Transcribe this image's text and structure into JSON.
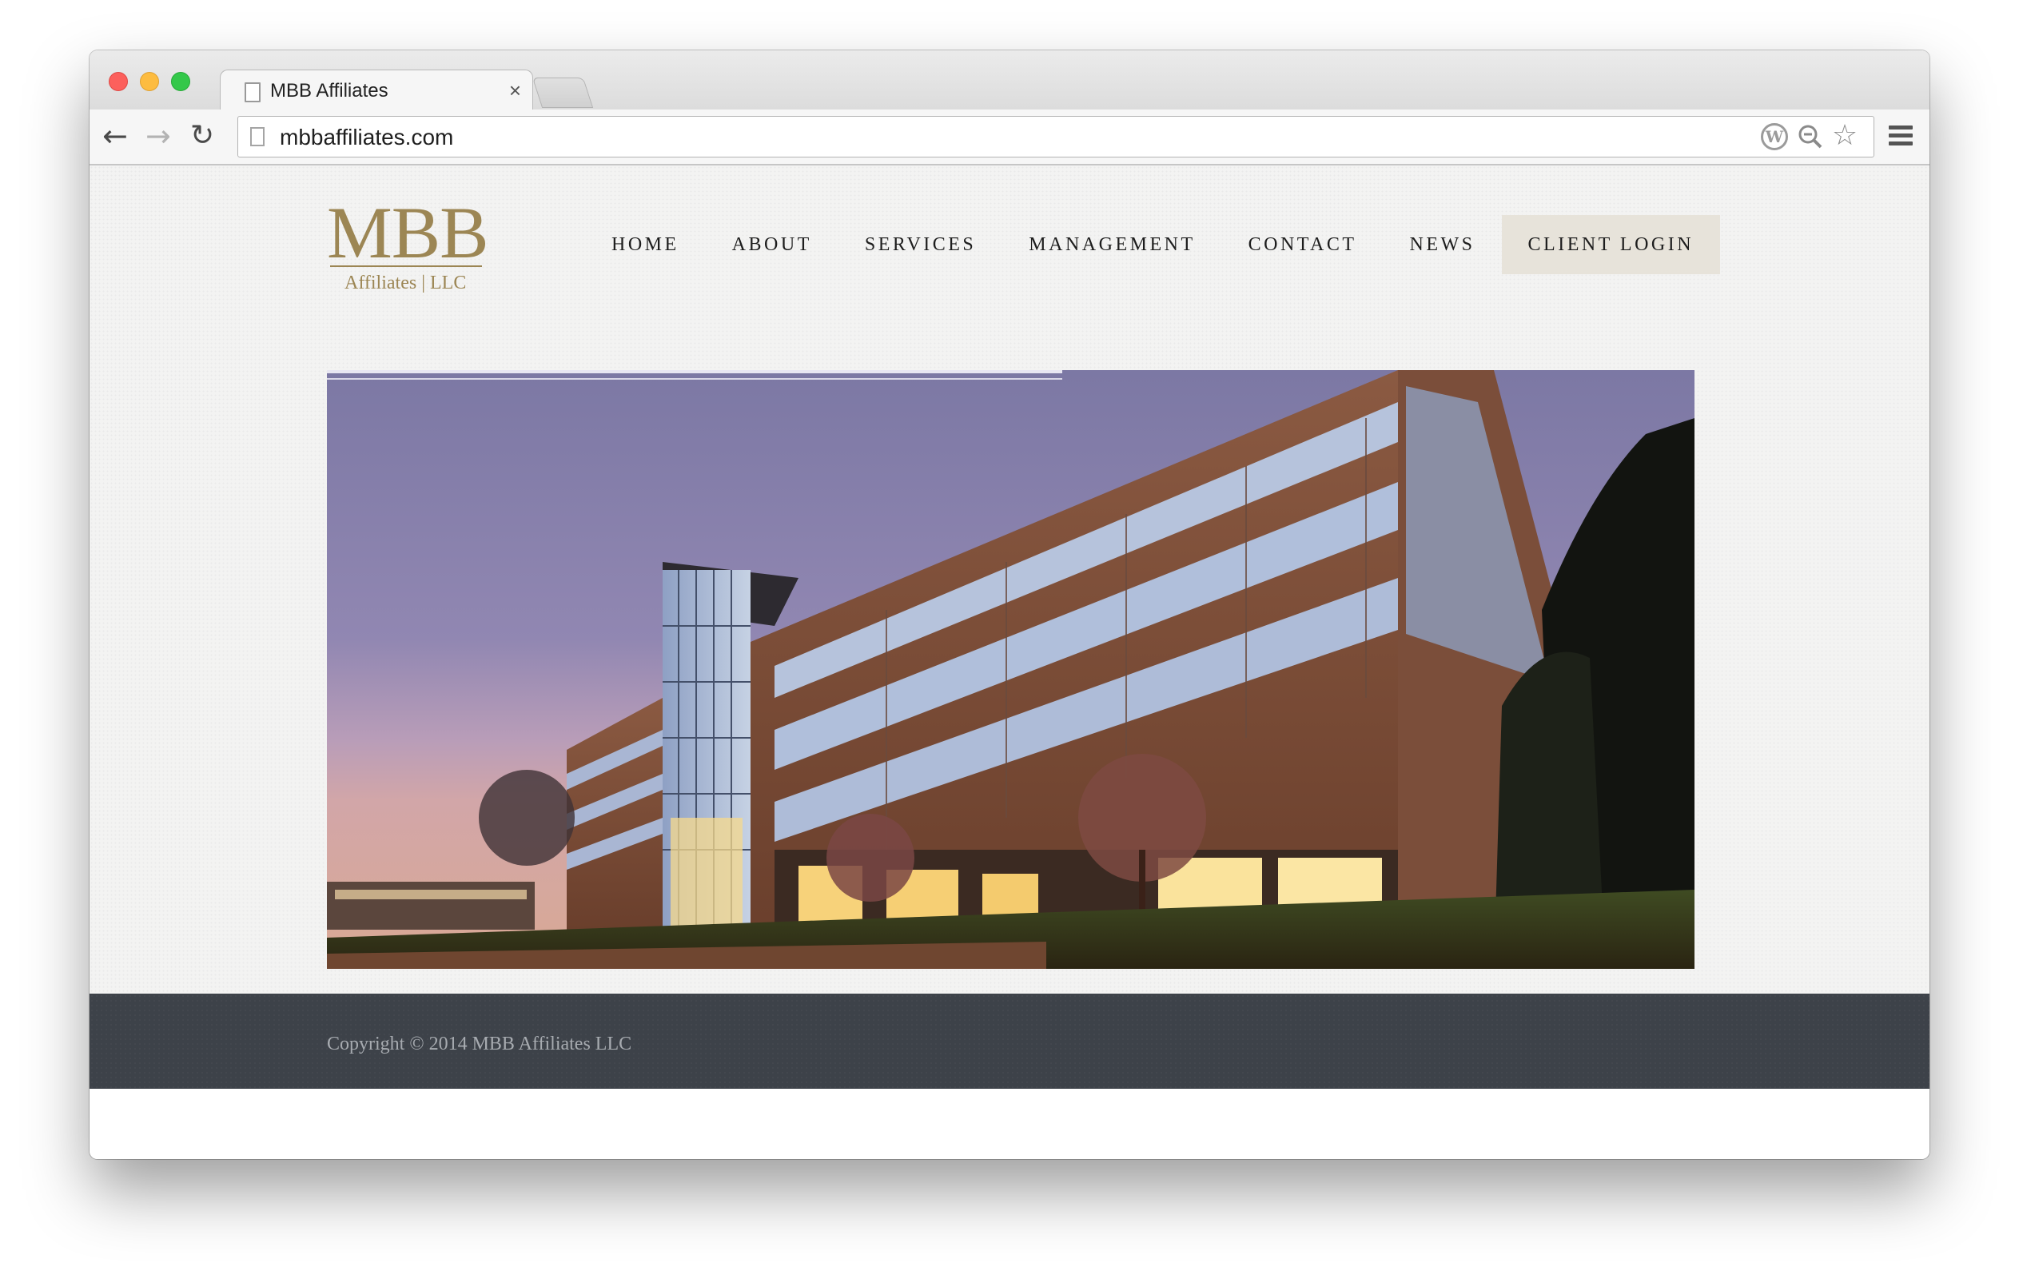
{
  "browser": {
    "tab_title": "MBB Affiliates",
    "tab_close": "×",
    "url": "mbbaffiliates.com",
    "back": "←",
    "forward": "→",
    "reload": "↻",
    "zoom_icon": "⊖",
    "star_icon": "☆",
    "wp_icon": "W"
  },
  "site": {
    "logo": {
      "main": "MBB",
      "sub": "Affiliates | LLC"
    },
    "nav": [
      {
        "label": "HOME"
      },
      {
        "label": "ABOUT"
      },
      {
        "label": "SERVICES"
      },
      {
        "label": "MANAGEMENT"
      },
      {
        "label": "CONTACT"
      },
      {
        "label": "NEWS"
      },
      {
        "label": "CLIENT LOGIN"
      }
    ],
    "footer": {
      "copyright": "Copyright © 2014 MBB Affiliates LLC"
    }
  },
  "colors": {
    "brand_gold": "#9c8654",
    "login_bg": "#e7e3da",
    "footer_bg": "#3d4249",
    "page_bg": "#f3f3f2"
  }
}
